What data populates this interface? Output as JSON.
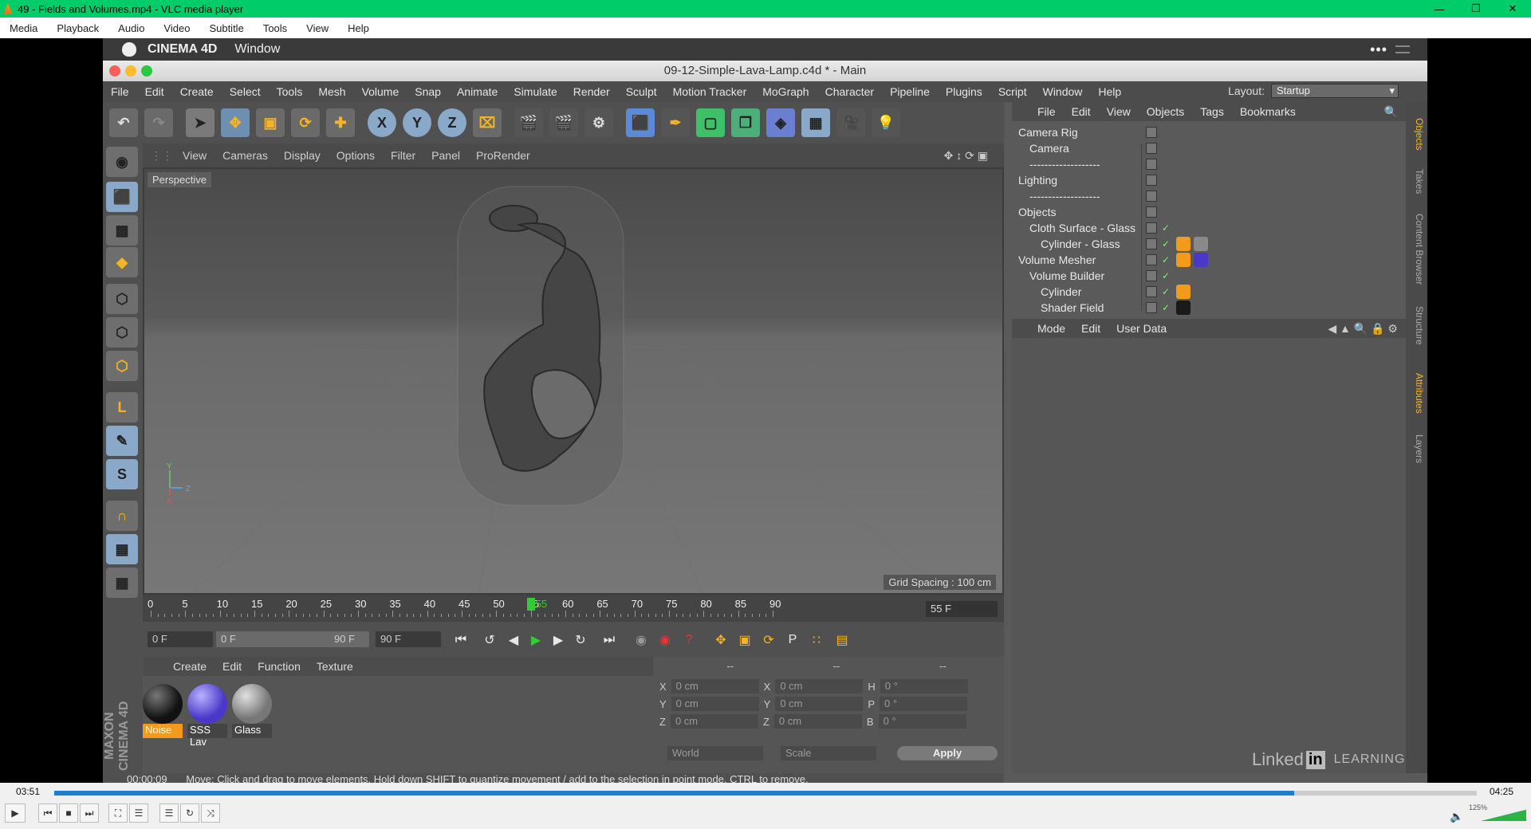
{
  "vlc": {
    "window_title": "49 - Fields and Volumes.mp4 - VLC media player",
    "menu": [
      "Media",
      "Playback",
      "Audio",
      "Video",
      "Subtitle",
      "Tools",
      "View",
      "Help"
    ],
    "time_elapsed": "03:51",
    "time_total": "04:25",
    "progress": 0.8717,
    "volume": "125%"
  },
  "mac": {
    "app": "CINEMA 4D",
    "menu_window": "Window"
  },
  "c4d": {
    "title": "09-12-Simple-Lava-Lamp.c4d * - Main",
    "menu": [
      "File",
      "Edit",
      "Create",
      "Select",
      "Tools",
      "Mesh",
      "Volume",
      "Snap",
      "Animate",
      "Simulate",
      "Render",
      "Sculpt",
      "Motion Tracker",
      "MoGraph",
      "Character",
      "Pipeline",
      "Plugins",
      "Script",
      "Window",
      "Help"
    ],
    "layout_label": "Layout:",
    "layout_value": "Startup",
    "viewport_menu": [
      "View",
      "Cameras",
      "Display",
      "Options",
      "Filter",
      "Panel",
      "ProRender"
    ],
    "viewport_label": "Perspective",
    "grid_spacing": "Grid Spacing : 100 cm",
    "timeline_ticks": [
      "0",
      "5",
      "10",
      "15",
      "20",
      "25",
      "30",
      "35",
      "40",
      "45",
      "50",
      "55",
      "60",
      "65",
      "70",
      "75",
      "80",
      "85",
      "90"
    ],
    "current_frame": "55",
    "current_frame_field": "55 F",
    "transport": {
      "start": "0 F",
      "range_start": "0 F",
      "range_end": "90 F",
      "end": "90 F"
    },
    "material_menu": [
      "Create",
      "Edit",
      "Function",
      "Texture"
    ],
    "materials": [
      {
        "name": "Noise",
        "color": "#1a1a1a",
        "selected": true
      },
      {
        "name": "SSS Lav",
        "color": "#5a4bd6",
        "selected": false
      },
      {
        "name": "Glass",
        "color": "#9aa0a6",
        "selected": false
      }
    ],
    "coords": {
      "header": [
        "--",
        "--",
        "--"
      ],
      "rows": [
        {
          "a": "X",
          "av": "0 cm",
          "b": "X",
          "bv": "0 cm",
          "c": "H",
          "cv": "0 °"
        },
        {
          "a": "Y",
          "av": "0 cm",
          "b": "Y",
          "bv": "0 cm",
          "c": "P",
          "cv": "0 °"
        },
        {
          "a": "Z",
          "av": "0 cm",
          "b": "Z",
          "bv": "0 cm",
          "c": "B",
          "cv": "0 °"
        }
      ],
      "world": "World",
      "scale": "Scale",
      "apply": "Apply"
    },
    "status_time": "00:00:09",
    "status_text": "Move: Click and drag to move elements. Hold down SHIFT to quantize movement / add to the selection in point mode, CTRL to remove.",
    "object_menu": [
      "File",
      "Edit",
      "View",
      "Objects",
      "Tags",
      "Bookmarks"
    ],
    "objects": [
      {
        "name": "Camera Rig",
        "indent": 0
      },
      {
        "name": "Camera",
        "indent": 1
      },
      {
        "name": "-------------------",
        "indent": 1
      },
      {
        "name": "Lighting",
        "indent": 0
      },
      {
        "name": "-------------------",
        "indent": 1
      },
      {
        "name": "Objects",
        "indent": 0
      },
      {
        "name": "Cloth Surface - Glass",
        "indent": 1
      },
      {
        "name": "Cylinder - Glass",
        "indent": 2
      },
      {
        "name": "Volume Mesher",
        "indent": 0
      },
      {
        "name": "Volume Builder",
        "indent": 1
      },
      {
        "name": "Cylinder",
        "indent": 2
      },
      {
        "name": "Shader Field",
        "indent": 2
      }
    ],
    "attr_menu": [
      "Mode",
      "Edit",
      "User Data"
    ],
    "side_tabs": [
      "Objects",
      "Takes",
      "Content Browser",
      "Structure",
      "Attributes",
      "Layers"
    ],
    "maxon": "MAXON CINEMA 4D"
  },
  "branding": {
    "linkedin_a": "Linked",
    "linkedin_in": "in",
    "learning": "LEARNING"
  }
}
